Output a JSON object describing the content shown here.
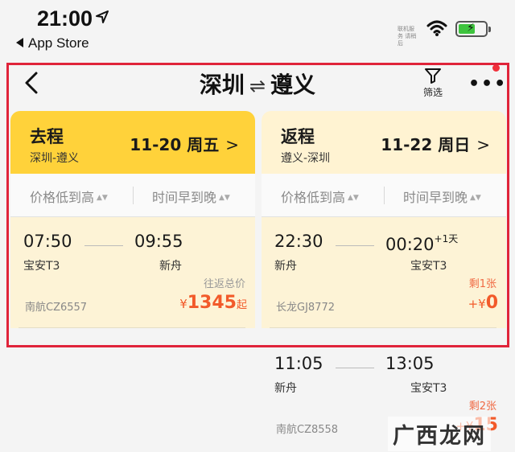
{
  "status_bar": {
    "time": "21:00",
    "back_app": "App Store",
    "tiny_note": "联机服务 请稍后"
  },
  "header": {
    "origin": "深圳",
    "swap_symbol": "⇌",
    "destination": "遵义",
    "filter_label": "筛选",
    "more_label": "•••"
  },
  "outbound": {
    "direction": "去程",
    "route": "深圳-遵义",
    "date": "11-20 周五",
    "chevron": ">",
    "sort": {
      "price": "价格低到高",
      "time": "时间早到晚"
    },
    "flights": [
      {
        "dep_time": "07:50",
        "dep_airport": "宝安T3",
        "arr_time": "09:55",
        "arr_airport": "新舟",
        "flight_no": "南航CZ6557",
        "note": "往返总价",
        "price_symbol": "¥",
        "price": "1345",
        "price_suffix": "起"
      }
    ]
  },
  "return": {
    "direction": "返程",
    "route": "遵义-深圳",
    "date": "11-22 周日",
    "chevron": ">",
    "sort": {
      "price": "价格低到高",
      "time": "时间早到晚"
    },
    "flights": [
      {
        "dep_time": "22:30",
        "dep_airport": "新舟",
        "arr_time": "00:20",
        "arr_plus": "+1天",
        "arr_airport": "宝安T3",
        "flight_no": "长龙GJ8772",
        "note": "剩1张",
        "price_symbol": "+¥",
        "price": "0"
      },
      {
        "dep_time": "11:05",
        "dep_airport": "新舟",
        "arr_time": "13:05",
        "arr_airport": "宝安T3",
        "flight_no": "南航CZ8558",
        "note": "剩2张",
        "price_symbol": "+¥",
        "price": "15"
      }
    ]
  },
  "watermark": "广西龙网",
  "colors": {
    "active_tab": "#ffd23a",
    "inactive_tab": "#fff3d2",
    "price": "#f25a2a",
    "highlight_border": "#e0243a"
  }
}
